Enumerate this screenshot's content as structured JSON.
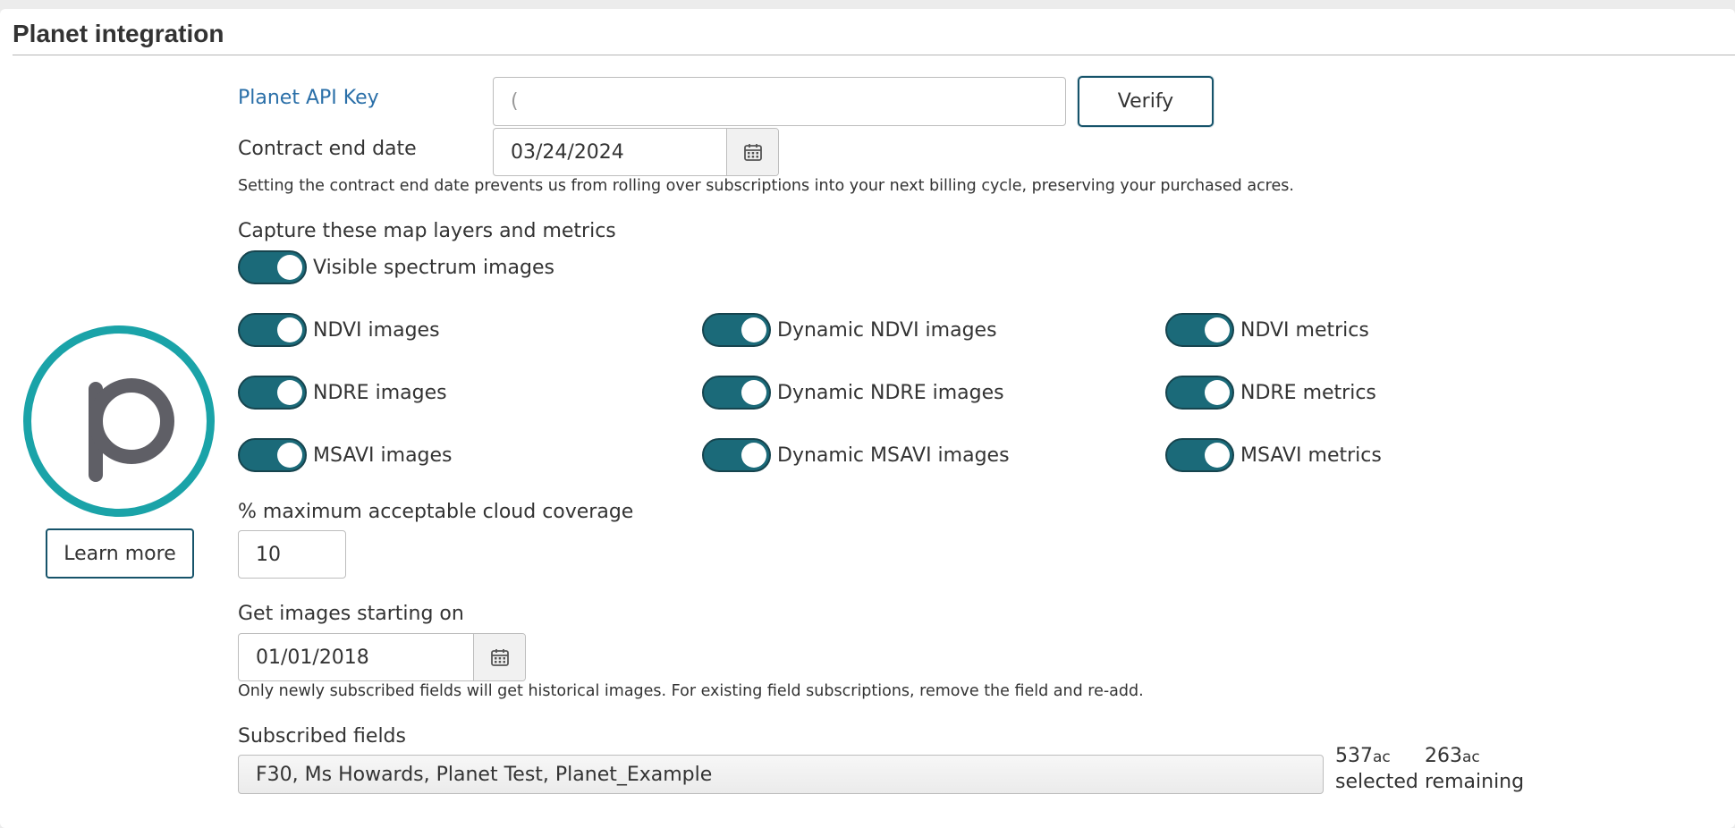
{
  "panel": {
    "title": "Planet integration"
  },
  "logo": {
    "learn_more_label": "Learn more"
  },
  "api_key": {
    "label": "Planet API Key",
    "value": "(",
    "verify_label": "Verify"
  },
  "contract": {
    "label": "Contract end date",
    "value": "03/24/2024",
    "help": "Setting the contract end date prevents us from rolling over subscriptions into your next billing cycle, preserving your purchased acres."
  },
  "capture": {
    "heading": "Capture these map layers and metrics",
    "visible": {
      "label": "Visible spectrum images",
      "on": true
    },
    "layers": [
      {
        "label": "NDVI images",
        "on": true
      },
      {
        "label": "Dynamic NDVI images",
        "on": true
      },
      {
        "label": "NDVI metrics",
        "on": true
      },
      {
        "label": "NDRE images",
        "on": true
      },
      {
        "label": "Dynamic NDRE images",
        "on": true
      },
      {
        "label": "NDRE metrics",
        "on": true
      },
      {
        "label": "MSAVI images",
        "on": true
      },
      {
        "label": "Dynamic MSAVI images",
        "on": true
      },
      {
        "label": "MSAVI metrics",
        "on": true
      }
    ]
  },
  "cloud": {
    "label": "% maximum acceptable cloud coverage",
    "value": "10"
  },
  "start": {
    "label": "Get images starting on",
    "value": "01/01/2018",
    "help": "Only newly subscribed fields will get historical images. For existing field subscriptions, remove the field and re-add."
  },
  "fields": {
    "label": "Subscribed fields",
    "value": "F30, Ms Howards, Planet Test, Planet_Example",
    "selected_value": "537",
    "selected_unit": "ac",
    "selected_label": "selected",
    "remaining_value": "263",
    "remaining_unit": "ac",
    "remaining_label": "remaining"
  },
  "colors": {
    "toggle_on": "#1b6a79",
    "logo_ring": "#1aa3a8",
    "link": "#2a6fa8",
    "button_border": "#16536a"
  },
  "icons": {
    "calendar": "calendar-icon",
    "logo": "planet-logo-icon"
  }
}
